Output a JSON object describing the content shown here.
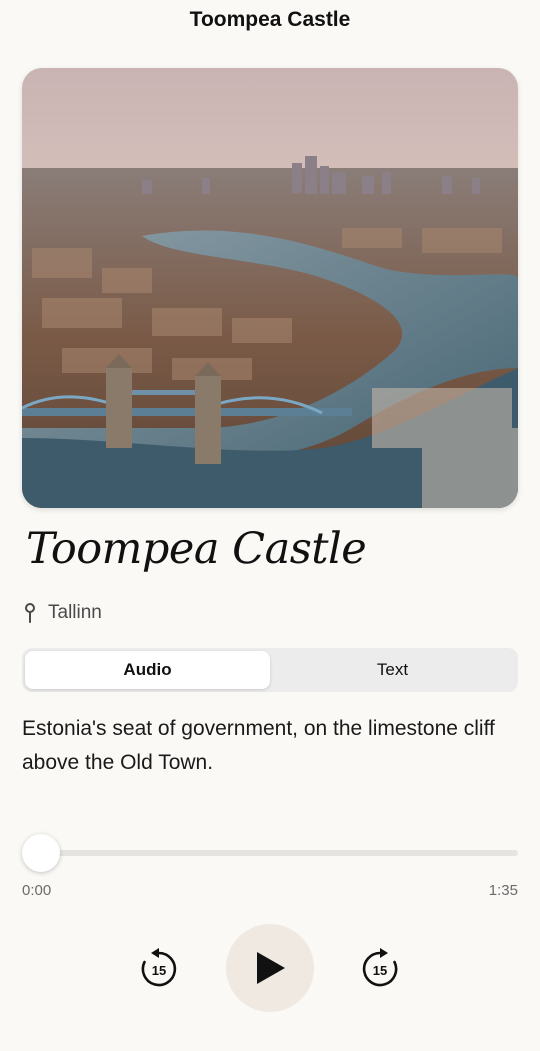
{
  "nav": {
    "title": "Toompea Castle"
  },
  "place": {
    "title": "Toompea Castle",
    "location": "Tallinn",
    "description": "Estonia's seat of government, on the limestone cliff above the Old Town."
  },
  "tabs": [
    {
      "label": "Audio",
      "selected": true
    },
    {
      "label": "Text",
      "selected": false
    }
  ],
  "player": {
    "current_time": "0:00",
    "duration": "1:35",
    "progress": 0,
    "skip_back_seconds": "15",
    "skip_forward_seconds": "15"
  },
  "colors": {
    "background": "#faf9f6",
    "play_button_bg": "#efe9e2",
    "accent_text": "#111111"
  },
  "icons": {
    "location": "pin-icon",
    "skip_back": "rotate-back-15-icon",
    "play": "play-icon",
    "skip_forward": "rotate-forward-15-icon"
  }
}
